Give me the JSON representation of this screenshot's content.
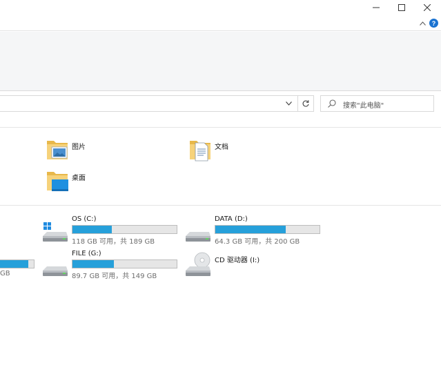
{
  "window": {
    "minimize_icon": "minimize-icon",
    "maximize_icon": "maximize-icon",
    "close_icon": "close-icon"
  },
  "ribbon": {
    "help_glyph": "?"
  },
  "address": {
    "search_placeholder": "搜索\"此电脑\""
  },
  "folders": [
    {
      "label": "图片",
      "icon": "pictures-folder-icon"
    },
    {
      "label": "文档",
      "icon": "documents-folder-icon"
    },
    {
      "label": "桌面",
      "icon": "desktop-folder-icon"
    }
  ],
  "drives": [
    {
      "name": "OS (C:)",
      "usage": "118 GB 可用，共 189 GB",
      "used_fraction": 0.376,
      "icon": "windows-drive-icon"
    },
    {
      "name": "DATA (D:)",
      "usage": "64.3 GB 可用，共 200 GB",
      "used_fraction": 0.678,
      "icon": "hard-drive-icon"
    },
    {
      "name": "FILE (G:)",
      "usage": "89.7 GB 可用，共 149 GB",
      "used_fraction": 0.398,
      "icon": "hard-drive-icon"
    },
    {
      "name": "CD 驱动器 (I:)",
      "icon": "cd-drive-icon"
    },
    {
      "usage": "GB",
      "used_fraction": 0.84,
      "icon": "hard-drive-icon"
    }
  ],
  "colors": {
    "bar_fill": "#26a0da",
    "help": "#1b73d1"
  }
}
